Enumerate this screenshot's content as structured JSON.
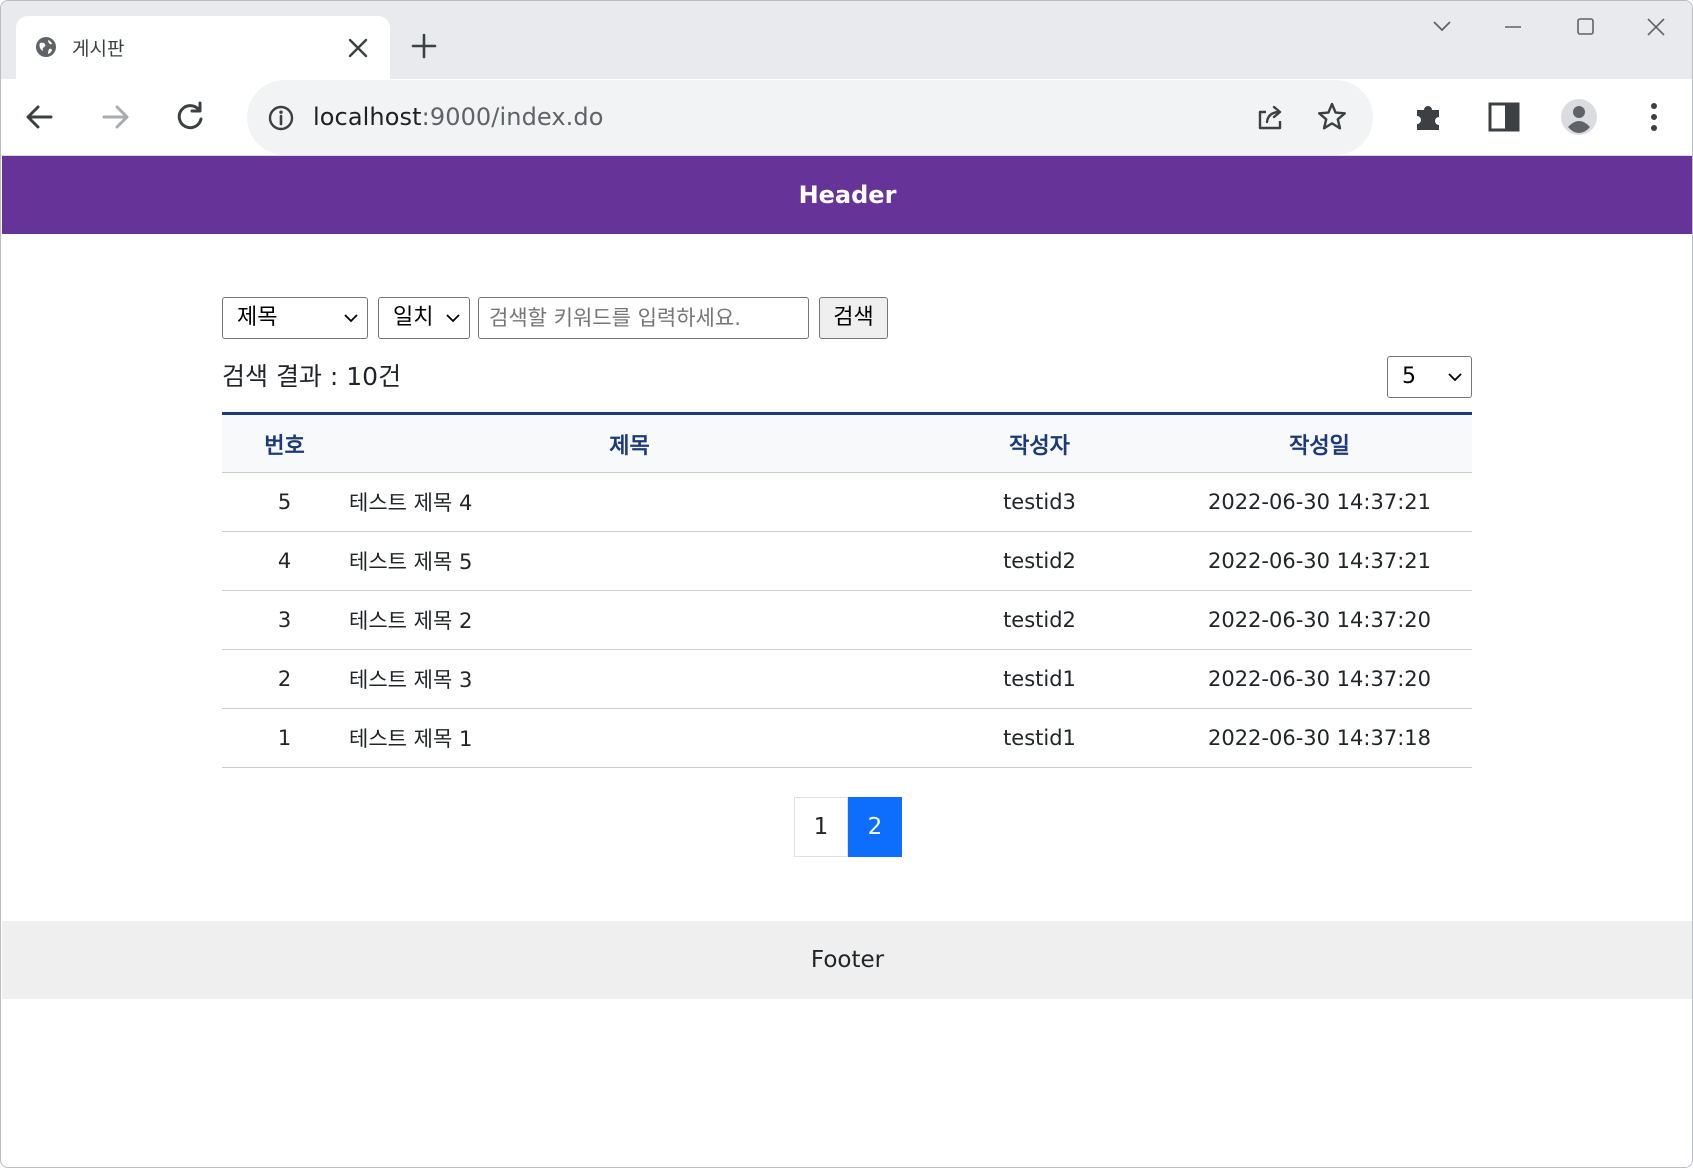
{
  "browser": {
    "tab_title": "게시판",
    "url_host": "localhost",
    "url_rest": ":9000/index.do"
  },
  "page": {
    "header": "Header",
    "footer": "Footer"
  },
  "search": {
    "field_value": "제목",
    "match_value": "일치",
    "keyword_placeholder": "검색할 키워드를 입력하세요.",
    "button_label": "검색"
  },
  "result": {
    "count_label": "검색 결과 : 10건",
    "page_size": "5"
  },
  "table": {
    "headers": [
      "번호",
      "제목",
      "작성자",
      "작성일"
    ],
    "rows": [
      {
        "no": "5",
        "title": "테스트 제목 4",
        "author": "testid3",
        "date": "2022-06-30 14:37:21"
      },
      {
        "no": "4",
        "title": "테스트 제목 5",
        "author": "testid2",
        "date": "2022-06-30 14:37:21"
      },
      {
        "no": "3",
        "title": "테스트 제목 2",
        "author": "testid2",
        "date": "2022-06-30 14:37:20"
      },
      {
        "no": "2",
        "title": "테스트 제목 3",
        "author": "testid1",
        "date": "2022-06-30 14:37:20"
      },
      {
        "no": "1",
        "title": "테스트 제목 1",
        "author": "testid1",
        "date": "2022-06-30 14:37:18"
      }
    ]
  },
  "pagination": {
    "pages": [
      "1",
      "2"
    ],
    "current": "2"
  },
  "colors": {
    "header_bg": "#663399",
    "table_header_text": "#1d3a7a",
    "active_page": "#0d6efd",
    "footer_bg": "#efefef"
  }
}
